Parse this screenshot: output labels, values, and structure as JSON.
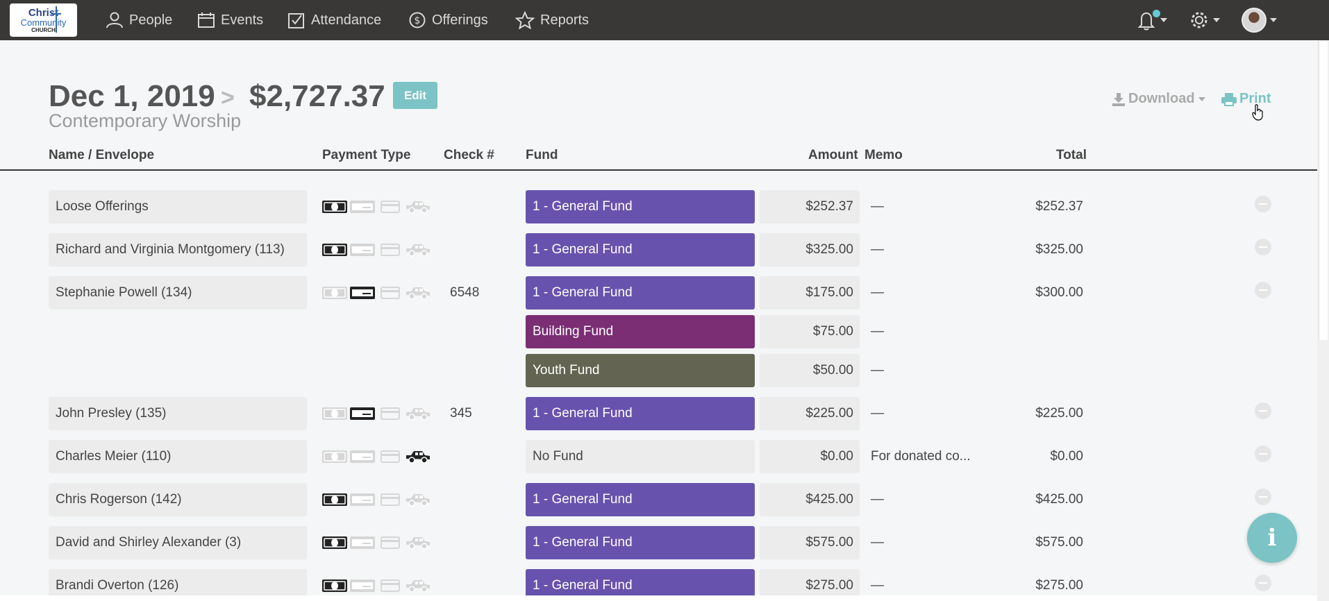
{
  "logo": {
    "line1": "Christ",
    "line2": "Community",
    "line3": "CHURCH"
  },
  "nav": [
    {
      "label": "People",
      "icon": "people-icon"
    },
    {
      "label": "Events",
      "icon": "calendar-icon"
    },
    {
      "label": "Attendance",
      "icon": "checkbox-icon"
    },
    {
      "label": "Offerings",
      "icon": "dollar-coin-icon"
    },
    {
      "label": "Reports",
      "icon": "star-icon"
    }
  ],
  "header": {
    "date": "Dec 1, 2019",
    "separator": ">",
    "amount": "$2,727.37",
    "edit_label": "Edit",
    "subtitle": "Contemporary Worship",
    "download_label": "Download",
    "print_label": "Print"
  },
  "columns": {
    "name": "Name / Envelope",
    "payment": "Payment Type",
    "check": "Check #",
    "fund": "Fund",
    "amount": "Amount",
    "memo": "Memo",
    "total": "Total"
  },
  "rows": [
    {
      "name": "Loose Offerings",
      "pay": "cash",
      "check": "",
      "fund": "1 - General Fund",
      "fund_color": "#6753ad",
      "amount": "$252.37",
      "memo": "—",
      "total": "$252.37"
    },
    {
      "name": "Richard and Virginia Montgomery (113)",
      "pay": "cash",
      "check": "",
      "fund": "1 - General Fund",
      "fund_color": "#6753ad",
      "amount": "$325.00",
      "memo": "—",
      "total": "$325.00"
    },
    {
      "name": "Stephanie Powell (134)",
      "pay": "check",
      "check": "6548",
      "fund": "1 - General Fund",
      "fund_color": "#6753ad",
      "amount": "$175.00",
      "memo": "—",
      "total": "$300.00"
    },
    {
      "name": "",
      "pay": "",
      "check": "",
      "fund": "Building Fund",
      "fund_color": "#7b2e74",
      "amount": "$75.00",
      "memo": "—",
      "total": ""
    },
    {
      "name": "",
      "pay": "",
      "check": "",
      "fund": "Youth Fund",
      "fund_color": "#636552",
      "amount": "$50.00",
      "memo": "—",
      "total": ""
    },
    {
      "name": "John Presley (135)",
      "pay": "check",
      "check": "345",
      "fund": "1 - General Fund",
      "fund_color": "#6753ad",
      "amount": "$225.00",
      "memo": "—",
      "total": "$225.00"
    },
    {
      "name": "Charles Meier (110)",
      "pay": "car",
      "check": "",
      "fund": "No Fund",
      "fund_color": "#ececec",
      "amount": "$0.00",
      "memo": "For donated co...",
      "total": "$0.00"
    },
    {
      "name": "Chris Rogerson (142)",
      "pay": "cash",
      "check": "",
      "fund": "1 - General Fund",
      "fund_color": "#6753ad",
      "amount": "$425.00",
      "memo": "—",
      "total": "$425.00"
    },
    {
      "name": "David and Shirley Alexander (3)",
      "pay": "cash",
      "check": "",
      "fund": "1 - General Fund",
      "fund_color": "#6753ad",
      "amount": "$575.00",
      "memo": "—",
      "total": "$575.00"
    },
    {
      "name": "Brandi Overton (126)",
      "pay": "cash",
      "check": "",
      "fund": "1 - General Fund",
      "fund_color": "#6753ad",
      "amount": "$275.00",
      "memo": "—",
      "total": "$275.00"
    }
  ],
  "info_button": "i",
  "colors": {
    "accent": "#7bc3c4",
    "general_fund": "#6753ad",
    "building_fund": "#7b2e74",
    "youth_fund": "#636552",
    "topbar": "#3a3836"
  }
}
